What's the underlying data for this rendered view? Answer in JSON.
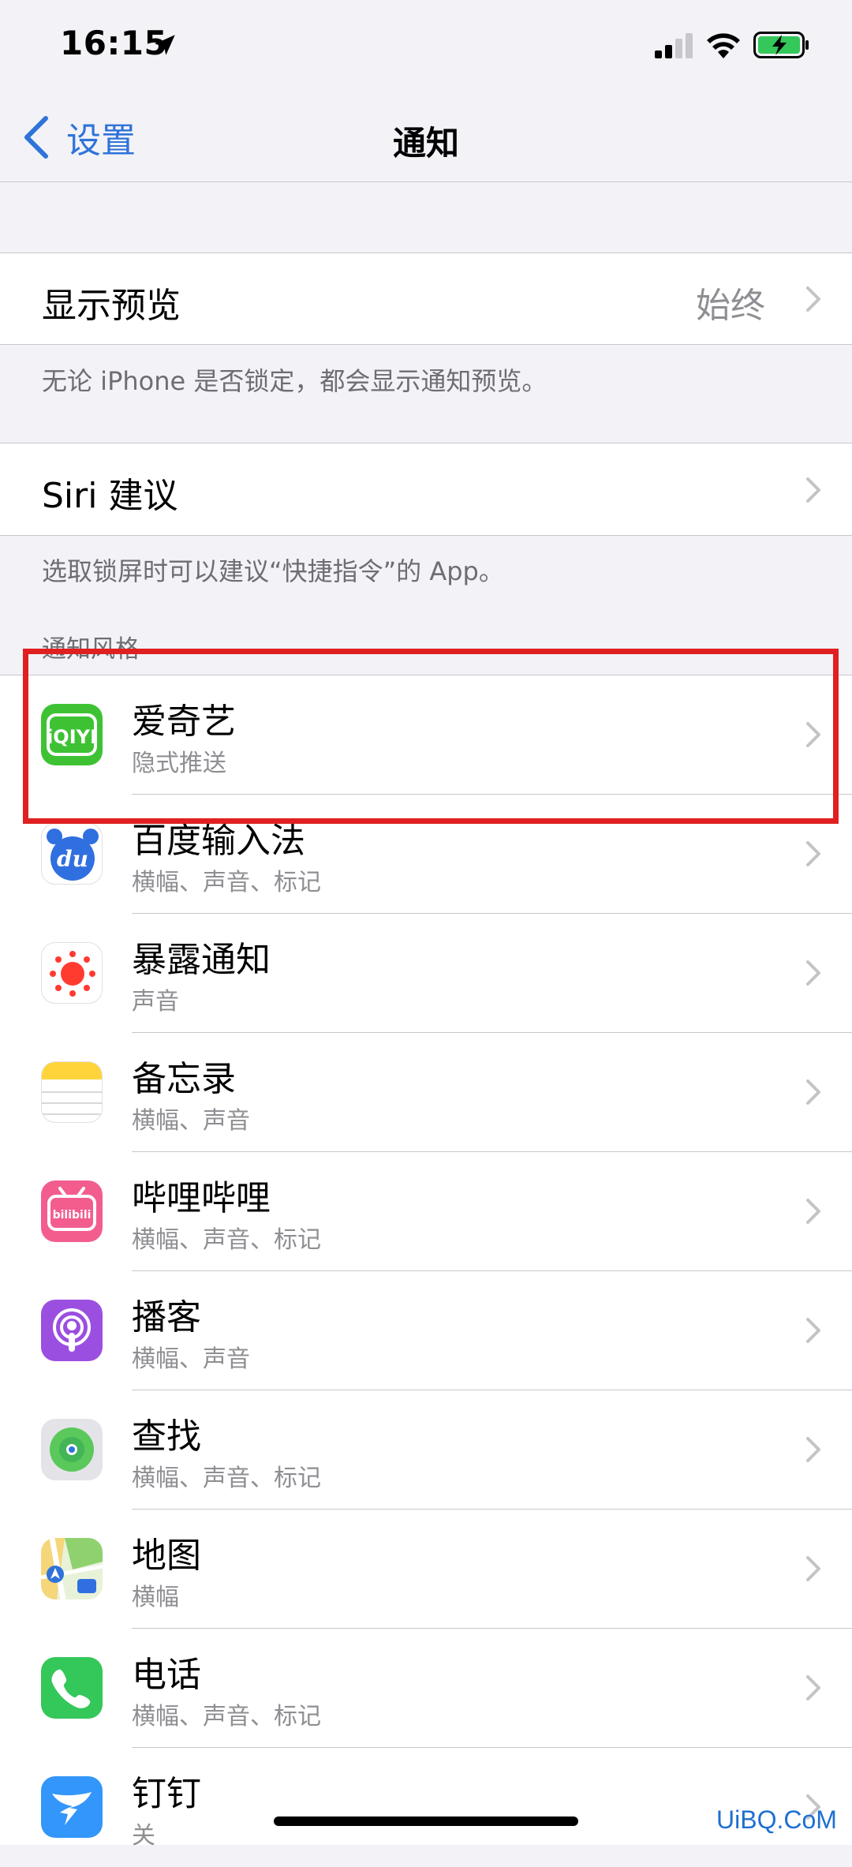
{
  "status_bar": {
    "time": "16:15"
  },
  "nav": {
    "back_label": "设置",
    "title": "通知"
  },
  "show_preview": {
    "label": "显示预览",
    "value": "始终",
    "footer": "无论 iPhone 是否锁定，都会显示通知预览。"
  },
  "siri": {
    "label": "Siri 建议",
    "footer": "选取锁屏时可以建议“快捷指令”的 App。"
  },
  "section_header": "通知风格",
  "apps": [
    {
      "name": "爱奇艺",
      "sub": "隐式推送",
      "icon": "iqiyi-icon",
      "color": "#3ec234"
    },
    {
      "name": "百度输入法",
      "sub": "横幅、声音、标记",
      "icon": "baidu-input-icon",
      "color": "#2f6fe0"
    },
    {
      "name": "暴露通知",
      "sub": "声音",
      "icon": "exposure-notification-icon",
      "color": "#ff3b30"
    },
    {
      "name": "备忘录",
      "sub": "横幅、声音",
      "icon": "notes-icon",
      "color": "#ffd43b"
    },
    {
      "name": "哔哩哔哩",
      "sub": "横幅、声音、标记",
      "icon": "bilibili-icon",
      "color": "#f25d8e"
    },
    {
      "name": "播客",
      "sub": "横幅、声音",
      "icon": "podcasts-icon",
      "color": "#9b4fe0"
    },
    {
      "name": "查找",
      "sub": "横幅、声音、标记",
      "icon": "find-my-icon",
      "color": "#34c759"
    },
    {
      "name": "地图",
      "sub": "横幅",
      "icon": "maps-icon",
      "color": "#5ac85a"
    },
    {
      "name": "电话",
      "sub": "横幅、声音、标记",
      "icon": "phone-icon",
      "color": "#34c759"
    },
    {
      "name": "钉钉",
      "sub": "关",
      "icon": "dingtalk-icon",
      "color": "#3296fa"
    }
  ],
  "watermark": "UiBQ.CoM",
  "colors": {
    "accent": "#2f73d9",
    "highlight": "#e02020",
    "background": "#f2f2f7"
  }
}
